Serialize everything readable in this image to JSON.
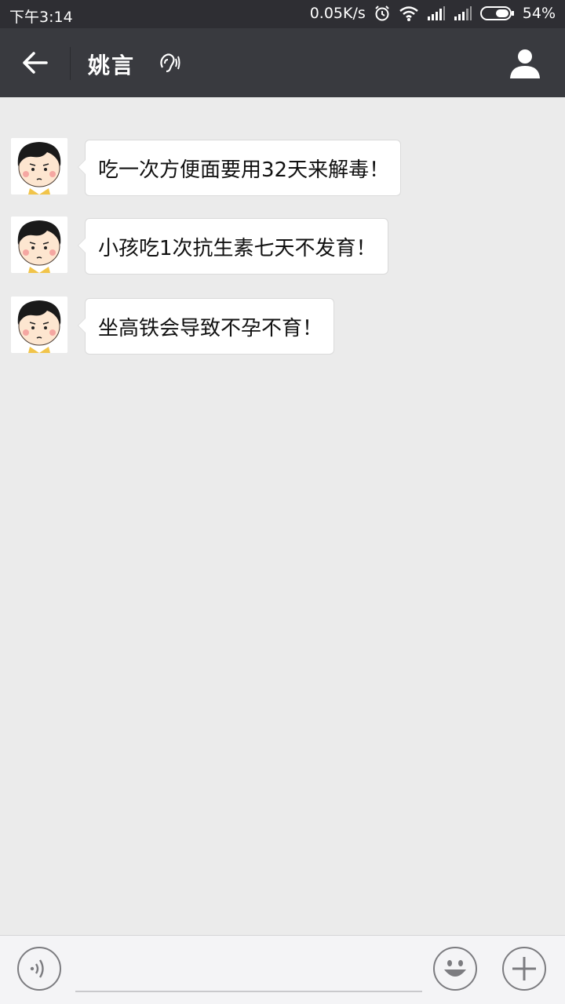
{
  "status_bar": {
    "time": "下午3:14",
    "net_speed": "0.05K/s",
    "battery": "54%",
    "icons": [
      "alarm-icon",
      "wifi-icon",
      "signal-icon",
      "signal-icon",
      "battery-icon"
    ]
  },
  "header": {
    "title": "姚言",
    "icons": [
      "back-arrow-icon",
      "earpiece-icon",
      "profile-icon"
    ]
  },
  "messages": [
    {
      "sender": "姚言",
      "text": "吃一次方便面要用32天来解毒！"
    },
    {
      "sender": "姚言",
      "text": "小孩吃1次抗生素七天不发育！"
    },
    {
      "sender": "姚言",
      "text": "坐高铁会导致不孕不育！"
    }
  ],
  "input_bar": {
    "icons": [
      "voice-icon",
      "emoji-icon",
      "plus-icon"
    ]
  },
  "colors": {
    "header_bg": "#393a3f",
    "status_bg": "#2e2e33",
    "chat_bg": "#ebebeb",
    "bubble_bg": "#ffffff"
  }
}
